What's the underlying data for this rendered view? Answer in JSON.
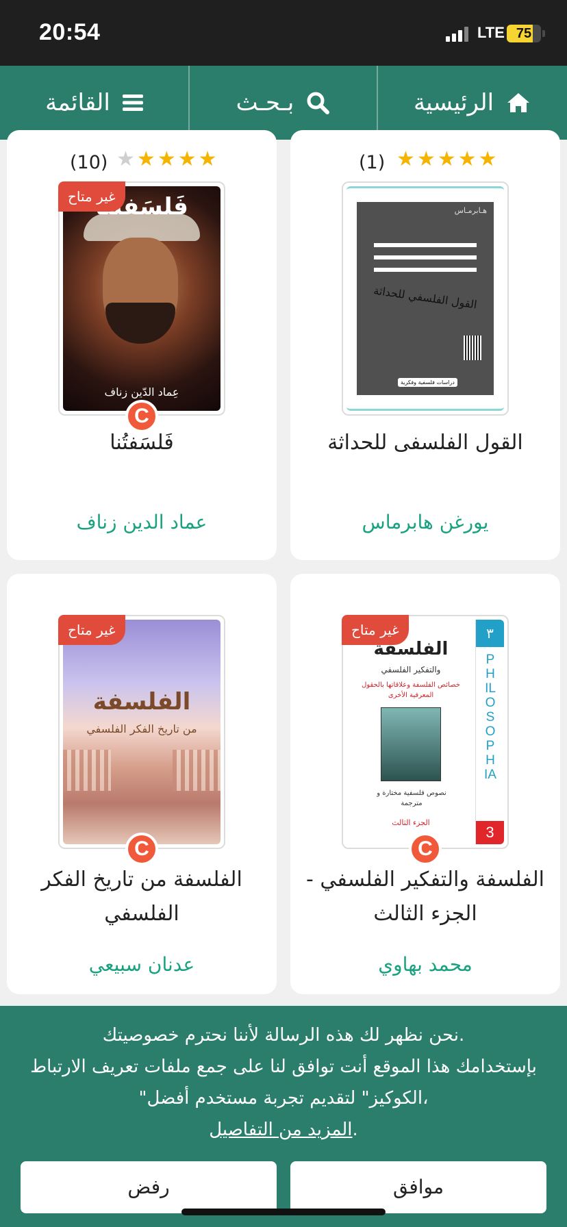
{
  "status_bar": {
    "time": "20:54",
    "network": "LTE",
    "battery": "75",
    "battery_level": 0.75
  },
  "nav": {
    "home": "الرئيسية",
    "search": "بـحـث",
    "menu": "القائمة"
  },
  "books": [
    {
      "title": "القول الفلسفى للحداثة",
      "author": "يورغن هابرماس",
      "rating": 5,
      "rating_count": "(1)",
      "badge": "",
      "cover_header": "هـابرمـاس",
      "cover_title": "القول الفلسفي للحداثة",
      "cover_footer": "دراسات فلسفية وفكرية"
    },
    {
      "title": "فَلسَفتُنا",
      "author": "عماد الدين زناف",
      "rating": 4.5,
      "rating_count": "(10)",
      "badge": "غير متاح",
      "cover_title": "فَلسَفتُنا",
      "cover_author": "عِماد الدّين زناف"
    },
    {
      "title": "الفلسفة والتفكير الفلسفي - الجزء الثالث",
      "author": "محمد بهاوي",
      "badge": "غير متاح",
      "cover_title": "الفلسفة",
      "cover_subtitle": "والتفكير الفلسفي",
      "cover_red": "خصائص الفلسفة وعلاقاتها بالحقول المعرفية الأخرى",
      "cover_texts": "نصوص فلسفية مختارة و مترجمة",
      "cover_part": "الجزء الثالث",
      "cover_side": "PHILOSOPHIA",
      "cover_num": "3"
    },
    {
      "title": "الفلسفة من تاريخ الفكر الفلسفي",
      "author": "عدنان سبيعي",
      "badge": "غير متاح",
      "cover_title": "الفلسفة",
      "cover_subtitle": "من تاريخ الفكر الفلسفي"
    }
  ],
  "cookie": {
    "line1": "نحن نظهر لك هذه الرسالة لأننا نحترم خصوصيتك.",
    "line2": "بإستخدامك هذا الموقع أنت توافق لنا على جمع ملفات تعريف الارتباط",
    "line3": "\"الكوكيز\" لتقديم تجربة مستخدم أفضل،",
    "link": "المزيد من التفاصيل",
    "accept": "موافق",
    "reject": "رفض"
  },
  "colors": {
    "brand": "#2a7e6b",
    "author": "#1aa280",
    "badge": "#e14b3c",
    "star": "#f4b400"
  }
}
